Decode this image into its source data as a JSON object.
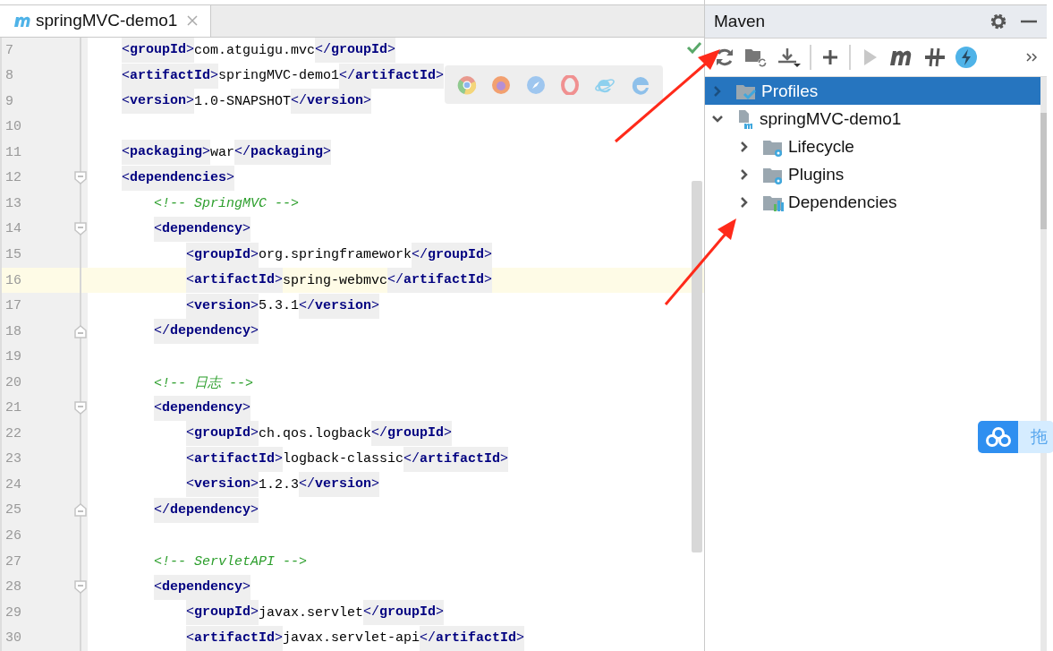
{
  "editor_tab": {
    "label": "springMVC-demo1",
    "selected": true
  },
  "code_lines": [
    {
      "number": "7",
      "current": false,
      "kind": "outer",
      "tokens": [
        {
          "kind": "tag",
          "text": "<**groupId**>"
        },
        {
          "kind": "text",
          "text": "com.atguigu.mvc"
        },
        {
          "kind": "tag",
          "text": "</**groupId**>"
        }
      ]
    },
    {
      "number": "8",
      "current": false,
      "kind": "outer",
      "tokens": [
        {
          "kind": "tag",
          "text": "<**artifactId**>"
        },
        {
          "kind": "text",
          "text": "springMVC-demo1"
        },
        {
          "kind": "tag",
          "text": "</**artifactId**>"
        }
      ]
    },
    {
      "number": "9",
      "current": false,
      "kind": "outer",
      "tokens": [
        {
          "kind": "tag",
          "text": "<**version**>"
        },
        {
          "kind": "text",
          "text": "1.0-SNAPSHOT"
        },
        {
          "kind": "tag",
          "text": "</**version**>"
        }
      ]
    },
    {
      "number": "10",
      "current": false
    },
    {
      "number": "11",
      "current": false,
      "kind": "outer",
      "tokens": [
        {
          "kind": "tag",
          "text": "<**packaging**>"
        },
        {
          "kind": "text",
          "text": "war"
        },
        {
          "kind": "tag",
          "text": "</**packaging**>"
        }
      ]
    },
    {
      "number": "12",
      "current": false,
      "fold_open": true,
      "kind": "outer",
      "tokens": [
        {
          "kind": "tag",
          "text": "<**dependencies**>"
        }
      ]
    },
    {
      "number": "13",
      "current": false,
      "kind": "middle",
      "tokens": [
        {
          "kind": "comment",
          "text": "<!-- SpringMVC -->"
        }
      ]
    },
    {
      "number": "14",
      "current": false,
      "fold_open": true,
      "kind": "middle",
      "tokens": [
        {
          "kind": "tag",
          "text": "<**dependency**>"
        }
      ]
    },
    {
      "number": "15",
      "current": false,
      "kind": "inner",
      "tokens": [
        {
          "kind": "tag",
          "text": "<**groupId**>"
        },
        {
          "kind": "text",
          "text": "org.springframework"
        },
        {
          "kind": "tag",
          "text": "</**groupId**>"
        }
      ]
    },
    {
      "number": "16",
      "current": true,
      "kind": "inner",
      "tokens": [
        {
          "kind": "tag",
          "text": "<**artifactId**>"
        },
        {
          "kind": "text",
          "text": "spring-webmvc"
        },
        {
          "kind": "tag",
          "text": "</**artifactId**>"
        }
      ]
    },
    {
      "number": "17",
      "current": false,
      "kind": "inner",
      "tokens": [
        {
          "kind": "tag",
          "text": "<**version**>"
        },
        {
          "kind": "text",
          "text": "5.3.1"
        },
        {
          "kind": "tag",
          "text": "</**version**>"
        }
      ]
    },
    {
      "number": "18",
      "current": false,
      "fold_close": true,
      "kind": "middle",
      "tokens": [
        {
          "kind": "tag",
          "text": "</**dependency**>"
        }
      ]
    },
    {
      "number": "19",
      "current": false
    },
    {
      "number": "20",
      "current": false,
      "kind": "middle",
      "tokens": [
        {
          "kind": "comment",
          "text": "<!-- 日志 -->"
        }
      ]
    },
    {
      "number": "21",
      "current": false,
      "fold_open": true,
      "kind": "middle",
      "tokens": [
        {
          "kind": "tag",
          "text": "<**dependency**>"
        }
      ]
    },
    {
      "number": "22",
      "current": false,
      "kind": "inner",
      "tokens": [
        {
          "kind": "tag",
          "text": "<**groupId**>"
        },
        {
          "kind": "text",
          "text": "ch.qos.logback"
        },
        {
          "kind": "tag",
          "text": "</**groupId**>"
        }
      ]
    },
    {
      "number": "23",
      "current": false,
      "kind": "inner",
      "tokens": [
        {
          "kind": "tag",
          "text": "<**artifactId**>"
        },
        {
          "kind": "text",
          "text": "logback-classic"
        },
        {
          "kind": "tag",
          "text": "</**artifactId**>"
        }
      ]
    },
    {
      "number": "24",
      "current": false,
      "kind": "inner",
      "tokens": [
        {
          "kind": "tag",
          "text": "<**version**>"
        },
        {
          "kind": "text",
          "text": "1.2.3"
        },
        {
          "kind": "tag",
          "text": "</**version**>"
        }
      ]
    },
    {
      "number": "25",
      "current": false,
      "fold_close": true,
      "kind": "middle",
      "tokens": [
        {
          "kind": "tag",
          "text": "</**dependency**>"
        }
      ]
    },
    {
      "number": "26",
      "current": false
    },
    {
      "number": "27",
      "current": false,
      "kind": "middle",
      "tokens": [
        {
          "kind": "comment",
          "text": "<!-- ServletAPI -->"
        }
      ]
    },
    {
      "number": "28",
      "current": false,
      "fold_open": true,
      "kind": "middle",
      "tokens": [
        {
          "kind": "tag",
          "text": "<**dependency**>"
        }
      ]
    },
    {
      "number": "29",
      "current": false,
      "kind": "inner",
      "tokens": [
        {
          "kind": "tag",
          "text": "<**groupId**>"
        },
        {
          "kind": "text",
          "text": "javax.servlet"
        },
        {
          "kind": "tag",
          "text": "</**groupId**>"
        }
      ]
    },
    {
      "number": "30",
      "current": false,
      "kind": "inner",
      "tokens": [
        {
          "kind": "tag",
          "text": "<**artifactId**>"
        },
        {
          "kind": "text",
          "text": "javax.servlet-api"
        },
        {
          "kind": "tag",
          "text": "</**artifactId**>"
        }
      ]
    }
  ],
  "maven": {
    "title": "Maven",
    "tree": [
      {
        "label": "Profiles",
        "kind": "profiles",
        "selected": true,
        "expanded": false
      },
      {
        "label": "springMVC-demo1",
        "kind": "project",
        "selected": false,
        "expanded": true,
        "children": [
          {
            "label": "Lifecycle",
            "kind": "lifecycle",
            "selected": false,
            "expanded": false
          },
          {
            "label": "Plugins",
            "kind": "plugins",
            "selected": false,
            "expanded": false
          },
          {
            "label": "Dependencies",
            "kind": "dependencies",
            "selected": false,
            "expanded": false
          }
        ]
      }
    ]
  },
  "drag_widget": {
    "label": "拖"
  }
}
